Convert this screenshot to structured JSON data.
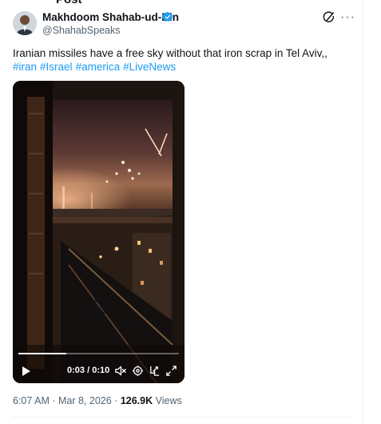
{
  "page": {
    "header_text_cut": "Post"
  },
  "author": {
    "name": "Makhdoom Shahab-ud-Din",
    "handle": "@ShahabSpeaks",
    "verified_color": "#1d9bf0"
  },
  "tweet": {
    "text": "Iranian missiles have a free sky without that iron scrap in Tel Aviv,,",
    "hashtags": [
      "#iran",
      "#Israel",
      "#america",
      "#LiveNews"
    ]
  },
  "video": {
    "emoji": "😱",
    "current_time": "0:03",
    "separator": " / ",
    "duration": "0:10",
    "progress_fraction": 0.3
  },
  "meta": {
    "time": "6:07 AM",
    "separator": " · ",
    "date": "Mar 8, 2026",
    "views_count": "126.9K",
    "views_label": " Views"
  },
  "icons": [
    "verified-icon",
    "grok-icon",
    "more-icon",
    "play-icon",
    "volume-mute-icon",
    "settings-icon",
    "pip-icon",
    "fullscreen-icon"
  ],
  "colors": {
    "link": "#1d9bf0",
    "secondary_text": "#536471",
    "primary_text": "#0f1419"
  }
}
